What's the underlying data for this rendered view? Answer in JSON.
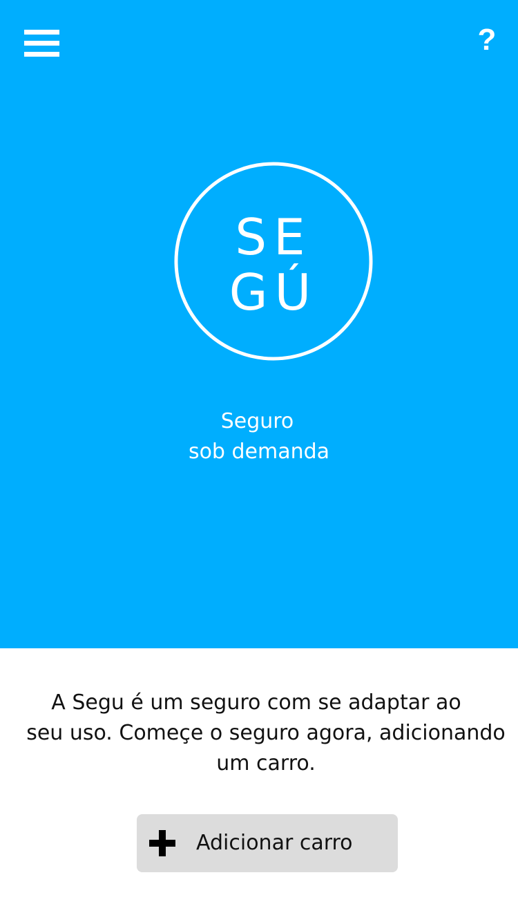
{
  "colors": {
    "hero_background": "#00aefe",
    "page_background": "#ffffff",
    "button_background": "#dcdcdc",
    "text_on_hero": "#ffffff",
    "body_text": "#111111"
  },
  "header": {
    "menu_icon": "hamburger-menu-icon",
    "help_label": "?"
  },
  "logo": {
    "line1": "SE",
    "line2": "GÚ"
  },
  "tagline": {
    "line1": "Seguro",
    "line2": "sob demanda"
  },
  "description": {
    "line1": "A Segu é um seguro com se adaptar ao",
    "line2": "seu uso. Começe o seguro agora, adicionando",
    "line3": "um carro."
  },
  "add_car_button": {
    "icon": "plus-icon",
    "label": "Adicionar carro"
  }
}
